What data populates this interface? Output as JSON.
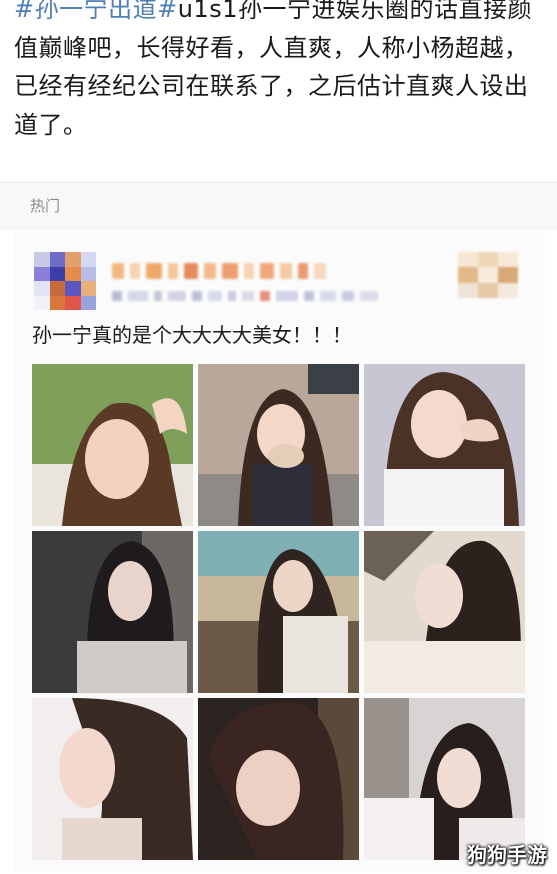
{
  "post": {
    "tag1": "#孙一宁出道#",
    "tag2": "u1s1",
    "body": "孙一宁进娱乐圈的话直接颜值巅峰吧，长得好看，人直爽，人称小杨超越，已经有经纪公司在联系了，之后估计直爽人设出道了。"
  },
  "section": {
    "label": "热门"
  },
  "comment": {
    "text": "孙一宁真的是个大大大大美女！！！",
    "photos": [
      {
        "name": "photo-1",
        "icon": "portrait-photo"
      },
      {
        "name": "photo-2",
        "icon": "portrait-photo-with-cat"
      },
      {
        "name": "photo-3",
        "icon": "portrait-photo"
      },
      {
        "name": "photo-4",
        "icon": "portrait-photo"
      },
      {
        "name": "photo-5",
        "icon": "portrait-photo-kitchen"
      },
      {
        "name": "photo-6",
        "icon": "portrait-photo"
      },
      {
        "name": "photo-7",
        "icon": "portrait-photo-profile"
      },
      {
        "name": "photo-8",
        "icon": "portrait-photo"
      },
      {
        "name": "photo-9",
        "icon": "portrait-photo"
      }
    ]
  },
  "watermark": {
    "text": "狗狗手游"
  },
  "colors": {
    "tag": "#4f7fb6",
    "hot_label": "#8a8a8a",
    "background": "#ffffff"
  }
}
